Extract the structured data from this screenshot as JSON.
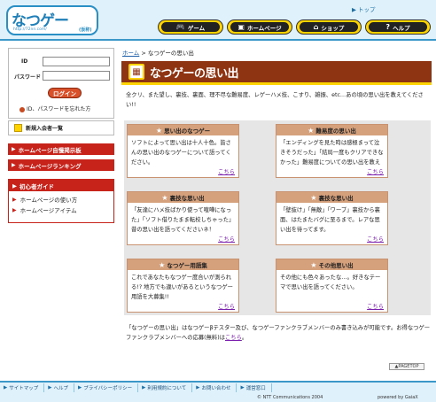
{
  "header": {
    "logo_title": "なつゲー",
    "logo_url": "http://72nn.com/",
    "logo_tag": "(仮称)",
    "top_link": "トップ",
    "nav": [
      {
        "label": "ゲーム",
        "icon": "gamepad-icon"
      },
      {
        "label": "ホームページ",
        "icon": "computer-icon"
      },
      {
        "label": "ショップ",
        "icon": "shop-icon"
      },
      {
        "label": "ヘルプ",
        "icon": "help-icon"
      }
    ]
  },
  "sidebar": {
    "login": {
      "id_label": "ID",
      "password_label": "パスワード",
      "id_value": "",
      "password_value": "",
      "button_label": "ログイン",
      "forgot_label": "ID、パスワードを忘れた方"
    },
    "new_members_label": "新規入会者一覧",
    "red_links": [
      "ホームページ自慢掲示板",
      "ホームページランキング"
    ],
    "guide": {
      "title": "初心者ガイド",
      "items": [
        "ホームページの使い方",
        "ホームページアイテム"
      ]
    }
  },
  "main": {
    "breadcrumb_home": "ホーム",
    "breadcrumb_sep": " > ",
    "breadcrumb_current": "なつゲーの思い出",
    "page_title": "なつゲーの思い出",
    "intro": "全クリ、また望し、裏技、裏面、理不尽な難易度、レゲーハメ技、こすり、雑振、etc…あの頃の思い出を教えてください!!",
    "cards": [
      {
        "title": "思い出のなつゲー",
        "body": "ソフトによって思い出は十人十色。皆さんの思い出のなつゲーについて語ってください。",
        "more": "こちら"
      },
      {
        "title": "難易度の思い出",
        "body": "「エンディングを見た時は感極まって泣きそうだった」「結局一度もクリアできなかった」難易度についての思い出を教えてください。",
        "more": "こちら"
      },
      {
        "title": "裏技な思い出",
        "body": "「友達にハメ技ばかり使って喧嘩になった」「ソフト借りたまま転校しちゃった」昔の思い出を語ってくださいネ！",
        "more": "こちら"
      },
      {
        "title": "裏技な思い出",
        "body": "「壁抜け」「無敵」「ワープ」裏技から裏面、はたまたバグに至るまで。レアな思い出を待ってます。",
        "more": "こちら"
      },
      {
        "title": "なつゲー用語集",
        "body": "これであなたもなつゲー度合いが測られる!? 地方でも違いがあるというなつゲー用語を大募集!!",
        "more": "こちら"
      },
      {
        "title": "その他思い出",
        "body": "その他にも色々あったな…。好きなテーマで思い出を語ってください。",
        "more": "こちら"
      }
    ],
    "note_text": "「なつゲーの思い出」はなつゲーβテスター及び、なつゲーファンクラブメンバーのみ書き込みが可能です。お得なつゲーファンクラブメンバーへの応募(無料)は",
    "note_link": "こちら",
    "note_end": "。",
    "pagetop": "PAGETOP"
  },
  "footer": {
    "links": [
      "サイトマップ",
      "ヘルプ",
      "プライバシーポリシー",
      "利用規約について",
      "お問い合わせ",
      "運営窓口"
    ],
    "copyright": "© NTT Communications 2004",
    "powered": "powered by GaiaX"
  },
  "colors": {
    "header_bg": "#dff1fb",
    "accent_blue": "#2a8fc4",
    "title_brown": "#8e3412",
    "card_head": "#d5a07c",
    "red_nav": "#c8231b",
    "nav_yellow": "#ffd400"
  }
}
